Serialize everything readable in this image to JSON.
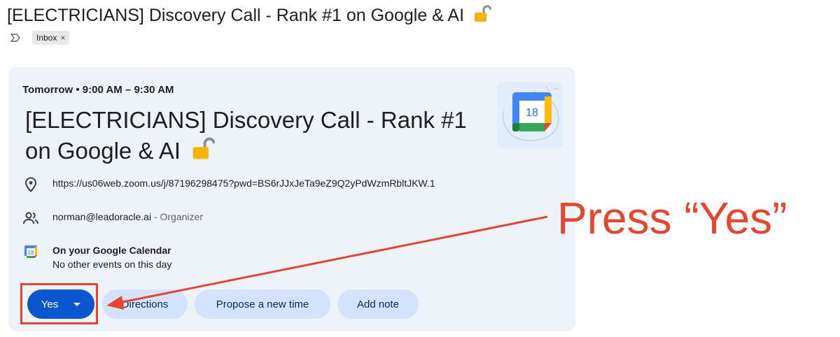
{
  "email": {
    "subject": "[ELECTRICIANS] Discovery Call - Rank #1 on Google & AI",
    "label_chip": "Inbox",
    "label_remove": "×"
  },
  "event": {
    "when": "Tomorrow • 9:00 AM – 9:30 AM",
    "title": "[ELECTRICIANS] Discovery Call - Rank #1 on Google & AI",
    "calendar_day": "18",
    "location": "https://us06web.zoom.us/j/87196298475?pwd=BS6rJJxJeTa9eZ9Q2yPdWzmRbltJKW.1",
    "organizer_email": "norman@leadoracle.ai",
    "organizer_role": " - Organizer",
    "calendar_line1": "On your Google Calendar",
    "calendar_line2": "No other events on this day"
  },
  "actions": {
    "yes": "Yes",
    "directions": "Directions",
    "propose": "Propose a new time",
    "add_note": "Add note"
  },
  "annotation": {
    "text": "Press “Yes”"
  },
  "colors": {
    "primary": "#0b57d0",
    "tonal": "#d3e3fd",
    "card_bg": "#eef2f9",
    "annotation": "#e8452f"
  },
  "icons": [
    "lock-open-icon",
    "importance-marker-icon",
    "location-pin-icon",
    "people-icon",
    "google-calendar-icon",
    "dropdown-caret-icon"
  ]
}
